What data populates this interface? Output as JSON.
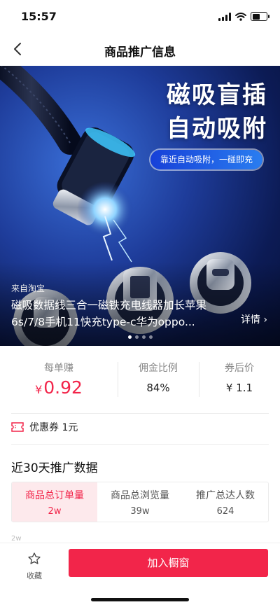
{
  "status": {
    "time": "15:57"
  },
  "nav": {
    "title": "商品推广信息"
  },
  "hero": {
    "headline_line1": "磁吸盲插",
    "headline_line2": "自动吸附",
    "pill": "靠近自动吸附，一碰即充",
    "source": "来自淘宝",
    "title": "磁吸数据线三合一磁铁充电线器加长苹果6s/7/8手机11快充type-c华为oppo...",
    "detail": "详情 ›",
    "dots": 4,
    "active_dot": 0
  },
  "stats": {
    "earn_label": "每单赚",
    "earn_currency": "¥",
    "earn_value": "0.92",
    "rate_label": "佣金比例",
    "rate_value": "84%",
    "after_label": "券后价",
    "after_value": "¥ 1.1"
  },
  "coupon": {
    "text": "优惠券 1元"
  },
  "section": {
    "title": "近30天推广数据"
  },
  "tabs": [
    {
      "label": "商品总订单量",
      "value": "2w"
    },
    {
      "label": "商品总浏览量",
      "value": "39w"
    },
    {
      "label": "推广总达人数",
      "value": "624"
    }
  ],
  "chart_hint": "2w",
  "bottom": {
    "fav_label": "收藏",
    "add_button": "加入橱窗"
  },
  "colors": {
    "accent": "#f2254a",
    "accent_light": "#fde9ec"
  }
}
